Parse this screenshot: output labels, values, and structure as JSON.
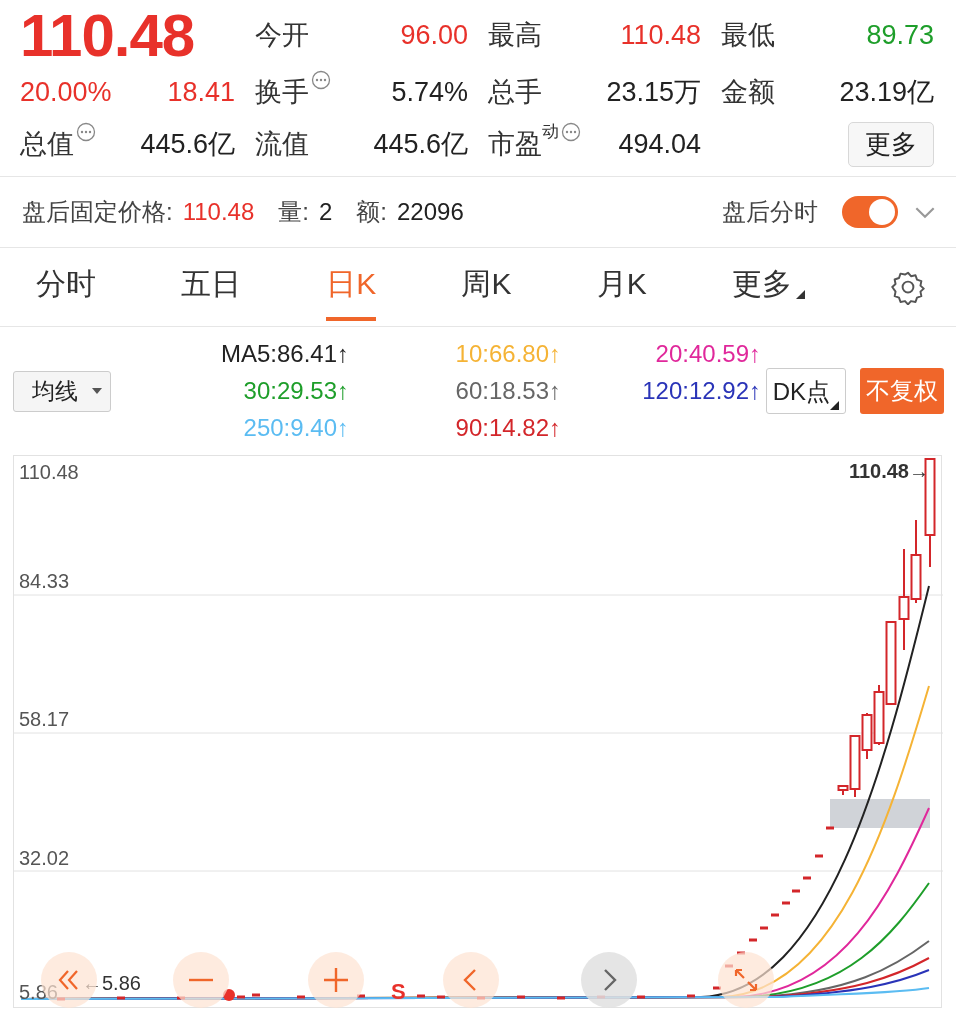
{
  "quote": {
    "price": "110.48",
    "change_pct": "20.00%",
    "change": "18.41"
  },
  "stats": [
    {
      "label": "今开",
      "value": "96.00",
      "color": "#e8312a"
    },
    {
      "label": "最高",
      "value": "110.48",
      "color": "#e8312a"
    },
    {
      "label": "最低",
      "value": "89.73",
      "color": "#1e9e2a"
    },
    {
      "label": "换手",
      "value": "5.74%",
      "color": "#222222",
      "info": true
    },
    {
      "label": "总手",
      "value": "23.15万",
      "color": "#222222"
    },
    {
      "label": "金额",
      "value": "23.19亿",
      "color": "#222222"
    },
    {
      "label": "总值",
      "value": "445.6亿",
      "color": "#222222",
      "info": true
    },
    {
      "label": "流值",
      "value": "445.6亿",
      "color": "#222222"
    },
    {
      "label": "市盈",
      "sup": "动",
      "value": "494.04",
      "color": "#222222",
      "info": true
    }
  ],
  "more_button": "更多",
  "after_hours": {
    "label": "盘后固定价格:",
    "price": "110.48",
    "volume_label": "量:",
    "volume": "2",
    "amount_label": "额:",
    "amount": "22096",
    "toggle_label": "盘后分时",
    "toggle_on": true
  },
  "tabs": [
    {
      "label": "分时",
      "selected": false
    },
    {
      "label": "五日",
      "selected": false
    },
    {
      "label": "日K",
      "selected": true
    },
    {
      "label": "周K",
      "selected": false
    },
    {
      "label": "月K",
      "selected": false
    },
    {
      "label": "更多",
      "selected": false,
      "menu": true
    }
  ],
  "indicator_select": "均线",
  "ma_legend": [
    {
      "text": "MA5:86.41↑",
      "color": "#222222"
    },
    {
      "text": "10:66.80↑",
      "color": "#f5b335"
    },
    {
      "text": "20:40.59↑",
      "color": "#e0289b"
    },
    {
      "text": "30:29.53↑",
      "color": "#1e9e2a"
    },
    {
      "text": "60:18.53↑",
      "color": "#666666"
    },
    {
      "text": "120:12.92↑",
      "color": "#2a34b8"
    },
    {
      "text": "250:9.40↑",
      "color": "#5bbcf2"
    },
    {
      "text": "90:14.82↑",
      "color": "#d3262a"
    }
  ],
  "dk_button": "DK点",
  "adjust_button": "不复权",
  "chart": {
    "y_labels": [
      "110.48",
      "84.33",
      "58.17",
      "32.02",
      "5.86"
    ],
    "high_marker": "110.48→",
    "low_marker": "←5.86",
    "signal": "S"
  }
}
